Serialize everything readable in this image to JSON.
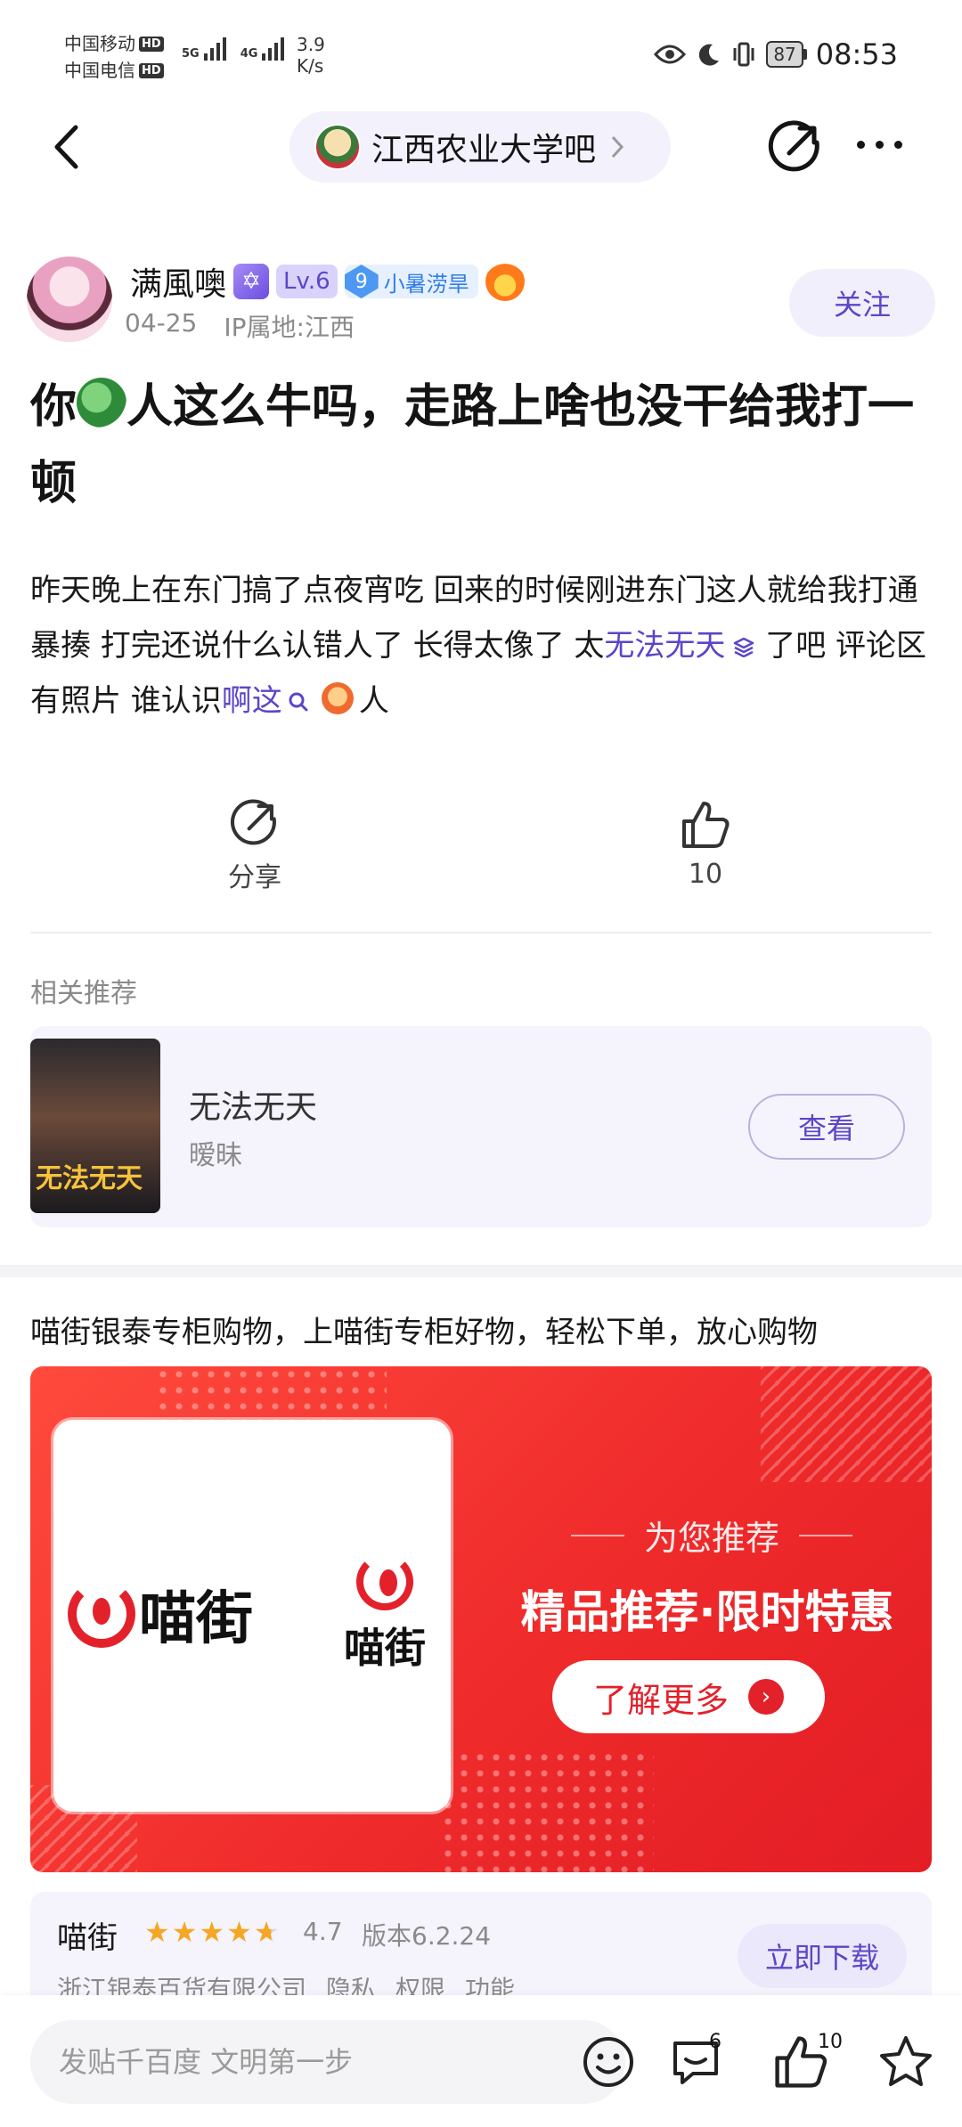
{
  "status_bar": {
    "carrier1": "中国移动",
    "carrier2": "中国电信",
    "hd": "HD",
    "net1": "5G",
    "net2": "4G",
    "speed_value": "3.9",
    "speed_unit": "K/s",
    "battery": "87",
    "time": "08:53",
    "icons": [
      "eye-icon",
      "moon-icon",
      "vibrate-icon",
      "battery-icon"
    ]
  },
  "nav": {
    "forum_name": "江西农业大学吧",
    "icons": [
      "back-arrow-icon",
      "forum-avatar-icon",
      "chevron-right-icon",
      "share-icon",
      "more-icon"
    ]
  },
  "author": {
    "name": "满風噢",
    "level": "Lv.6",
    "fan_level": "9",
    "fan_title": "小暑涝旱",
    "date": "04-25",
    "ip": "IP属地:江西",
    "follow_label": "关注"
  },
  "post": {
    "title_part1": "你",
    "title_part2": "人这么牛吗，走路上啥也没干给我打一顿",
    "body_part1": "昨天晚上在东门搞了点夜宵吃 回来的时候刚进东门这人就给我打通暴揍 打完还说什么认错人了 长得太像了 太",
    "body_link1": "无法无天",
    "body_part2": " 了吧 评论区有照片 谁认识",
    "body_link2": "啊这",
    "body_part3": "人"
  },
  "actions": {
    "share_label": "分享",
    "like_count": "10"
  },
  "recommend": {
    "section_title": "相关推荐",
    "book_title": "无法无天",
    "book_subtitle": "暧昧",
    "cover_text": "无法无天",
    "view_label": "查看"
  },
  "ad": {
    "headline": "喵街银泰专柜购物，上喵街专柜好物，轻松下单，放心购物",
    "logo_text": "喵街",
    "tagline": "为您推荐",
    "banner_title": "精品推荐·限时特惠",
    "cta": "了解更多",
    "app_name": "喵街",
    "rating": "4.7",
    "stars": 4.7,
    "version": "版本6.2.24",
    "company": "浙江银泰百货有限公司",
    "link_privacy": "隐私",
    "link_permissions": "权限",
    "link_features": "功能",
    "download_label": "立即下载"
  },
  "bottom_bar": {
    "input_placeholder": "发贴千百度 文明第一步",
    "comment_count": "6",
    "like_count": "10"
  },
  "colors": {
    "accent": "#5b46c7",
    "ad_red": "#e3212b",
    "muted": "#8a8a8a"
  }
}
